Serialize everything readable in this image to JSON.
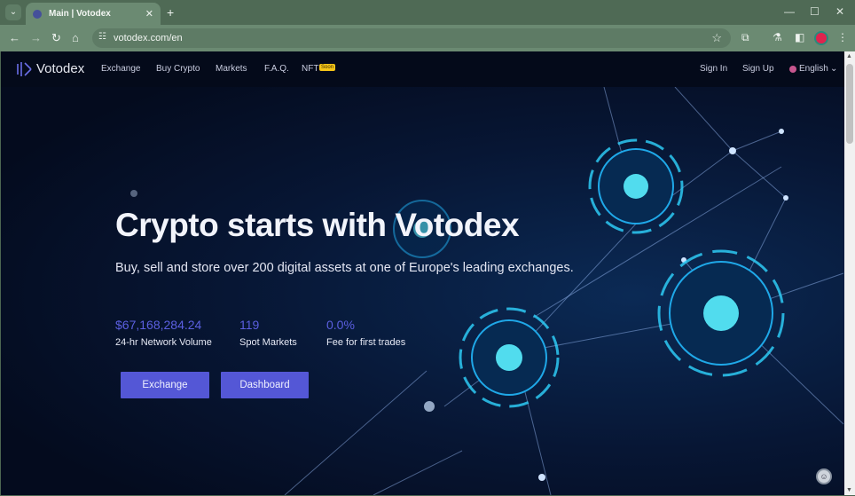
{
  "browser": {
    "tab_title": "Main | Votodex",
    "url": "votodex.com/en",
    "icons": [
      "tab-list-icon",
      "close-tab-icon",
      "new-tab-icon",
      "minimize-icon",
      "maximize-icon",
      "close-window-icon",
      "back-icon",
      "forward-icon",
      "reload-icon",
      "home-icon",
      "site-info-icon",
      "bookmark-star-icon",
      "extensions-icon",
      "labs-icon",
      "side-panel-icon",
      "profile-icon",
      "menu-icon"
    ]
  },
  "nav": {
    "logo": "Votodex",
    "links": [
      "Exchange",
      "Buy Crypto",
      "Markets",
      "F.A.Q.",
      "NFT"
    ],
    "nft_badge": "Soon",
    "sign_in": "Sign In",
    "sign_up": "Sign Up",
    "language": "English"
  },
  "hero": {
    "title": "Crypto starts with Votodex",
    "subtitle": "Buy, sell and store over 200 digital assets at one of Europe's leading exchanges.",
    "stats": [
      {
        "value": "$67,168,284.24",
        "label": "24-hr Network Volume"
      },
      {
        "value": "119",
        "label": "Spot Markets"
      },
      {
        "value": "0.0%",
        "label": "Fee for first trades"
      }
    ],
    "buttons": [
      "Exchange",
      "Dashboard"
    ]
  },
  "colors": {
    "accent": "#5457d6",
    "stat": "#5b5fe0",
    "badge": "#f5c518"
  }
}
